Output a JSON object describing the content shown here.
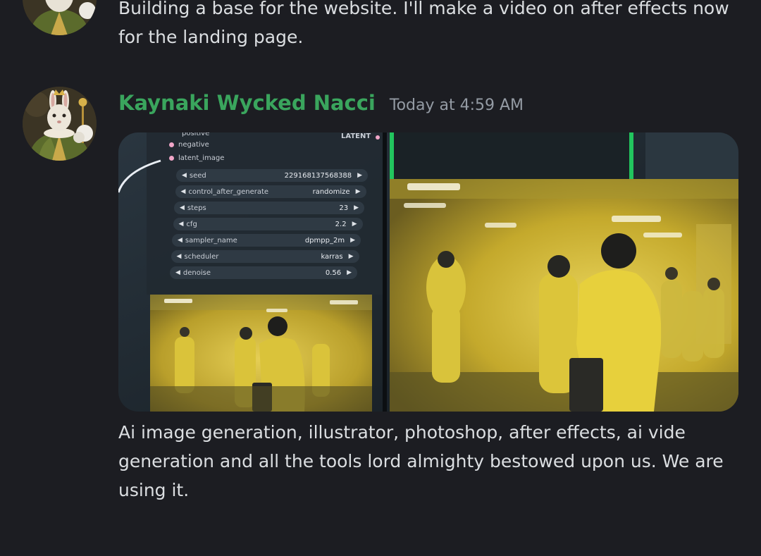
{
  "messages": [
    {
      "text": "Building a base for the website. I'll make a video on after effects now for the landing page."
    },
    {
      "author": "Kaynaki Wycked Nacci",
      "timestamp": "Today at 4:59 AM",
      "attachment": {
        "node_header": "positive",
        "node_inputs": [
          "negative",
          "latent_image"
        ],
        "output_label": "LATENT",
        "params": [
          {
            "name": "seed",
            "value": "229168137568388"
          },
          {
            "name": "control_after_generate",
            "value": "randomize"
          },
          {
            "name": "steps",
            "value": "23"
          },
          {
            "name": "cfg",
            "value": "2.2"
          },
          {
            "name": "sampler_name",
            "value": "dpmpp_2m"
          },
          {
            "name": "scheduler",
            "value": "karras"
          },
          {
            "name": "denoise",
            "value": "0.56"
          }
        ]
      },
      "text": "Ai image generation, illustrator, photoshop, after effects, ai vide generation and all the tools lord almighty bestowed upon us. We are using it."
    }
  ],
  "colors": {
    "background": "#1c1d22",
    "author_name": "#3aa55d",
    "timestamp": "#949ba4",
    "text": "#dbdee1"
  }
}
